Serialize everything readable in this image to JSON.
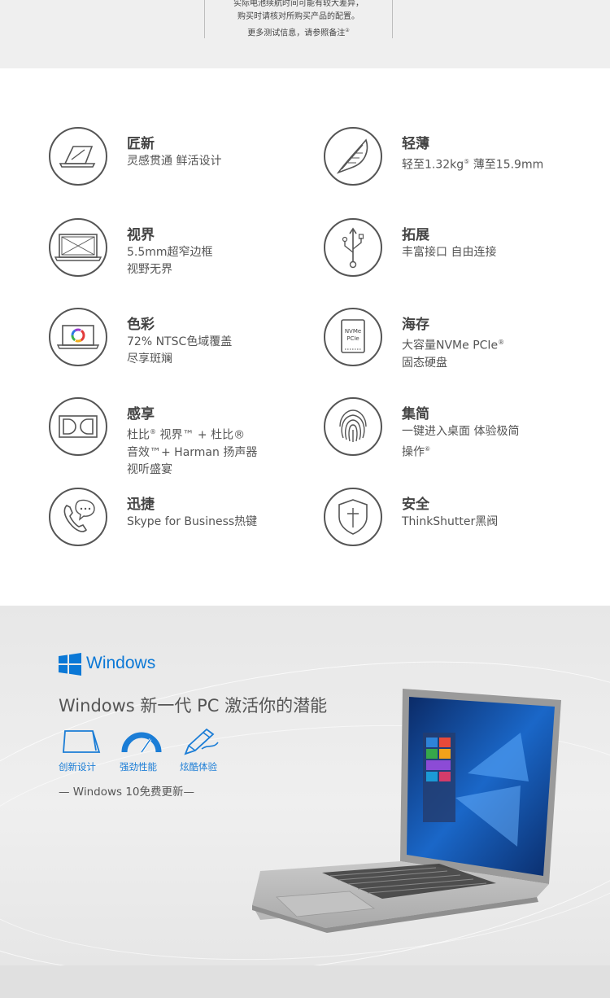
{
  "top_note": {
    "line1": "实际电池续航时间可能有较大差异，",
    "line2": "购买时请核对所购买产品的配置。",
    "line3": "更多测试信息，请参照备注",
    "line3_sup": "②"
  },
  "features": [
    {
      "icon": "laptop-pen-icon",
      "title": "匠新",
      "desc": "灵感贯通  鲜活设计",
      "sup": ""
    },
    {
      "icon": "feather-icon",
      "title": "轻薄",
      "desc": "轻至1.32kg",
      "sup": "⑤",
      "desc_after": "  薄至15.9mm"
    },
    {
      "icon": "monitor-bezel-icon",
      "title": "视界",
      "desc": "5.5mm超窄边框\n视野无界",
      "sup": ""
    },
    {
      "icon": "usb-icon",
      "title": "拓展",
      "desc": "丰富接口  自由连接",
      "sup": ""
    },
    {
      "icon": "color-laptop-icon",
      "title": "色彩",
      "desc": "72% NTSC色域覆盖\n尽享斑斓",
      "sup": ""
    },
    {
      "icon": "ssd-icon",
      "title": "海存",
      "desc": "大容量NVMe PCIe",
      "sup": "®",
      "desc_after": "\n固态硬盘"
    },
    {
      "icon": "dolby-icon",
      "title": "感享",
      "desc": "杜比",
      "sup": "®",
      "desc_after": " 视界™ + 杜比®\n音效™+ Harman 扬声器\n视听盛宴"
    },
    {
      "icon": "fingerprint-icon",
      "title": "集简",
      "desc": "一键进入桌面  体验极简\n操作",
      "sup": "⑥"
    },
    {
      "icon": "phone-chat-icon",
      "title": "迅捷",
      "desc": "Skype for Business热键",
      "sup": ""
    },
    {
      "icon": "shield-icon",
      "title": "安全",
      "desc": "ThinkShutter黑阀",
      "sup": ""
    }
  ],
  "ssd_icon_text": {
    "line1": "NVMe",
    "line2": "PCIe"
  },
  "windows": {
    "logo_text": "Windows",
    "headline": "Windows 新一代 PC 激活你的潜能",
    "icons": [
      {
        "name": "创新设计",
        "icon": "tablet-stand-icon"
      },
      {
        "name": "强劲性能",
        "icon": "speedometer-icon"
      },
      {
        "name": "炫酷体验",
        "icon": "pen-icon"
      }
    ],
    "tagline": "—  Windows 10免费更新—",
    "brand_color": "#0b78d6"
  }
}
